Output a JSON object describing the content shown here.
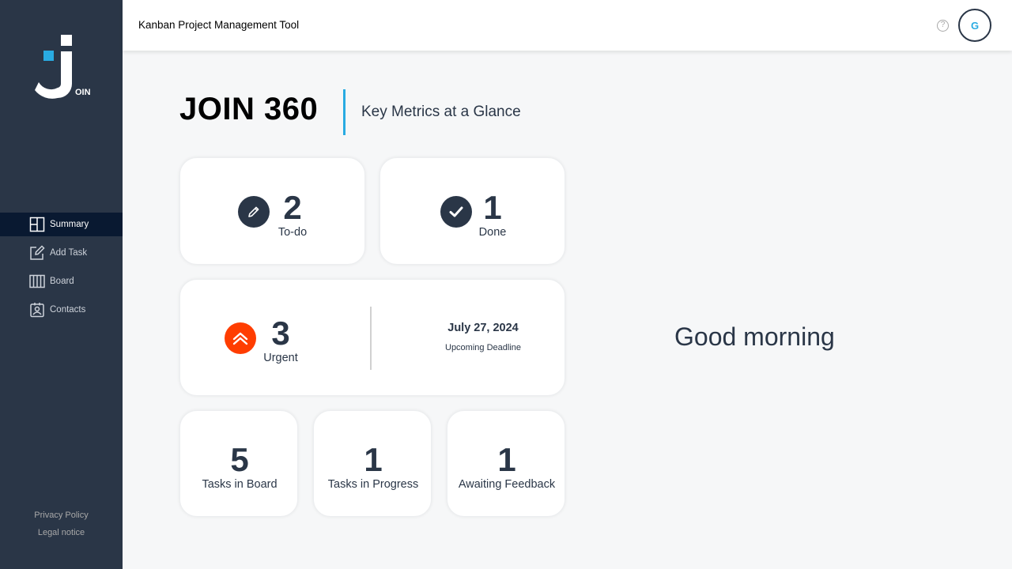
{
  "app": {
    "title": "Kanban Project Management Tool",
    "logo_suffix": "OIN"
  },
  "header": {
    "help_icon": "?",
    "avatar_initial": "G"
  },
  "sidebar": {
    "items": [
      {
        "label": "Summary",
        "icon": "summary-icon",
        "active": true
      },
      {
        "label": "Add Task",
        "icon": "add-task-icon",
        "active": false
      },
      {
        "label": "Board",
        "icon": "board-icon",
        "active": false
      },
      {
        "label": "Contacts",
        "icon": "contacts-icon",
        "active": false
      }
    ],
    "footer": {
      "privacy": "Privacy Policy",
      "legal": "Legal notice"
    }
  },
  "summary": {
    "title": "JOIN 360",
    "subtitle": "Key Metrics at a Glance",
    "todo": {
      "value": "2",
      "label": "To-do"
    },
    "done": {
      "value": "1",
      "label": "Done"
    },
    "urgent": {
      "value": "3",
      "label": "Urgent"
    },
    "deadline": {
      "date": "July 27, 2024",
      "label": "Upcoming Deadline"
    },
    "tasks_in_board": {
      "value": "5",
      "label": "Tasks in Board"
    },
    "tasks_in_progress": {
      "value": "1",
      "label": "Tasks in Progress"
    },
    "awaiting_feedback": {
      "value": "1",
      "label": "Awaiting Feedback"
    },
    "greeting": "Good morning"
  },
  "colors": {
    "sidebar": "#2a3647",
    "active_nav": "#091931",
    "accent": "#29abe2",
    "urgent": "#ff3d00"
  }
}
